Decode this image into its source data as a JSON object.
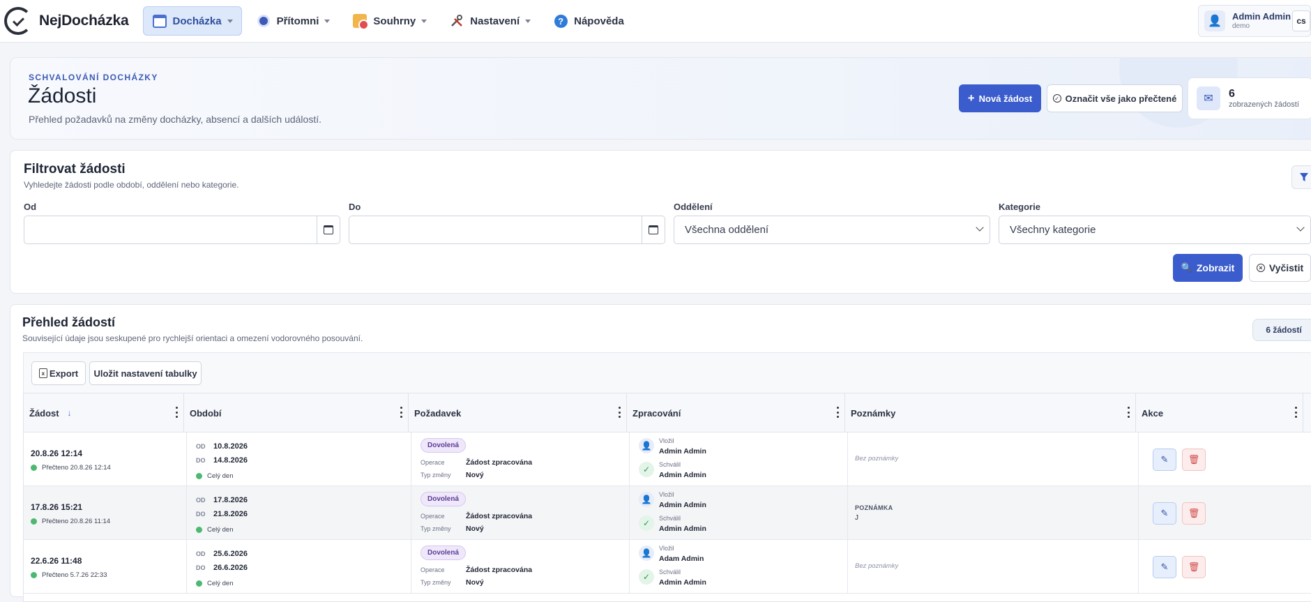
{
  "brand": {
    "name": "NejDocházka"
  },
  "nav": {
    "items": [
      {
        "label": "Docházka",
        "icon": "calendar-icon",
        "active": true
      },
      {
        "label": "Přítomni",
        "icon": "presence-icon"
      },
      {
        "label": "Souhrny",
        "icon": "summary-icon"
      },
      {
        "label": "Nastavení",
        "icon": "tools-icon"
      },
      {
        "label": "Nápověda",
        "icon": "help-icon"
      }
    ]
  },
  "user": {
    "name": "Admin Admin",
    "sub": "demo",
    "lang": "cs"
  },
  "hero": {
    "eyebrow": "SCHVALOVÁNÍ DOCHÁZKY",
    "title": "Žádosti",
    "subtitle": "Přehled požadavků na změny docházky, absencí a dalších událostí.",
    "new_button": "Nová žádost",
    "mark_read_button": "Označit vše jako přečtené",
    "stat_count": "6",
    "stat_label": "zobrazených žádostí"
  },
  "filter": {
    "title": "Filtrovat žádosti",
    "subtitle": "Vyhledejte žádosti podle období, oddělení nebo kategorie.",
    "from_label": "Od",
    "to_label": "Do",
    "dept_label": "Oddělení",
    "dept_value": "Všechna oddělení",
    "cat_label": "Kategorie",
    "cat_value": "Všechny kategorie",
    "show_button": "Zobrazit",
    "clear_button": "Vyčistit"
  },
  "list": {
    "title": "Přehled žádostí",
    "subtitle": "Související údaje jsou seskupené pro rychlejší orientaci a omezení vodorovného posouvání.",
    "count_pill": "6 žádostí",
    "export_button": "Export",
    "save_button": "Uložit nastavení tabulky",
    "columns": [
      "Žádost",
      "Období",
      "Požadavek",
      "Zpracování",
      "Poznámky",
      "Akce"
    ],
    "rows": [
      {
        "date": "20.8.26 12:14",
        "read": "Přečteno 20.8.26 12:14",
        "from_label": "OD",
        "from": "10.8.2026",
        "to_label": "DO",
        "to": "14.8.2026",
        "day": "Celý den",
        "badge": "Dovolená",
        "op_label": "Operace",
        "op": "Žádost zpracována",
        "type_label": "Typ změny",
        "type": "Nový",
        "inserted_label": "Vložil",
        "inserted": "Admin Admin",
        "approved_label": "Schválil",
        "approved": "Admin Admin",
        "note_label": "",
        "note": "Bez poznámky"
      },
      {
        "date": "17.8.26 15:21",
        "read": "Přečteno 20.8.26 11:14",
        "from_label": "OD",
        "from": "17.8.2026",
        "to_label": "DO",
        "to": "21.8.2026",
        "day": "Celý den",
        "badge": "Dovolená",
        "op_label": "Operace",
        "op": "Žádost zpracována",
        "type_label": "Typ změny",
        "type": "Nový",
        "inserted_label": "Vložil",
        "inserted": "Admin Admin",
        "approved_label": "Schválil",
        "approved": "Admin Admin",
        "note_label": "POZNÁMKA",
        "note": "J"
      },
      {
        "date": "22.6.26 11:48",
        "read": "Přečteno 5.7.26 22:33",
        "from_label": "OD",
        "from": "25.6.2026",
        "to_label": "DO",
        "to": "26.6.2026",
        "day": "Celý den",
        "badge": "Dovolená",
        "op_label": "Operace",
        "op": "Žádost zpracována",
        "type_label": "Typ změny",
        "type": "Nový",
        "inserted_label": "Vložil",
        "inserted": "Adam Admin",
        "approved_label": "Schválil",
        "approved": "Admin Admin",
        "note_label": "",
        "note": "Bez poznámky"
      }
    ]
  },
  "colors": {
    "accent": "#3a5ccc",
    "badge": "#efe7fa",
    "success": "#4cb871",
    "danger": "#d04848"
  }
}
